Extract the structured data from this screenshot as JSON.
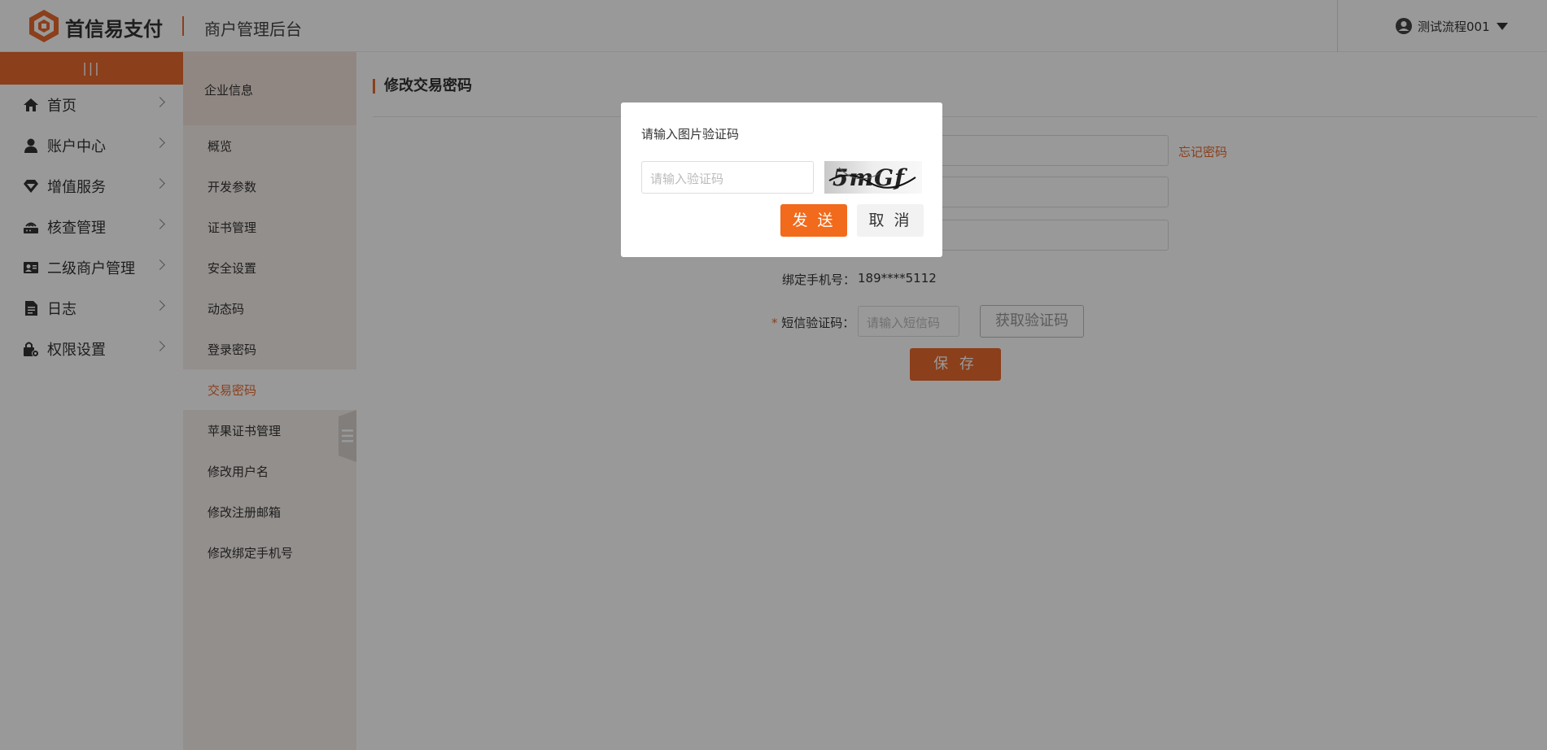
{
  "header": {
    "brand": "首信易支付",
    "subtitle": "商户管理后台",
    "user": "测试流程001"
  },
  "sidebar": {
    "toggle_label": "|||",
    "items": [
      {
        "label": "首页",
        "icon": "home-icon"
      },
      {
        "label": "账户中心",
        "icon": "user-icon"
      },
      {
        "label": "增值服务",
        "icon": "diamond-icon"
      },
      {
        "label": "核查管理",
        "icon": "router-icon"
      },
      {
        "label": "二级商户管理",
        "icon": "id-card-icon"
      },
      {
        "label": "日志",
        "icon": "document-icon"
      },
      {
        "label": "权限设置",
        "icon": "lock-gear-icon"
      }
    ]
  },
  "subnav": {
    "header": "企业信息",
    "items": [
      "概览",
      "开发参数",
      "证书管理",
      "安全设置",
      "动态码",
      "登录密码",
      "交易密码",
      "苹果证书管理",
      "修改用户名",
      "修改注册邮箱",
      "修改绑定手机号"
    ],
    "active_index": 6
  },
  "main": {
    "title": "修改交易密码",
    "forgot_link": "忘记密码",
    "phone_label": "绑定手机号：",
    "phone_value": "189****5112",
    "sms_label": "短信验证码：",
    "sms_required_mark": "*",
    "sms_placeholder": "请输入短信码",
    "sms_button": "获取验证码",
    "save_button": "保 存"
  },
  "modal": {
    "title": "请输入图片验证码",
    "captcha_placeholder": "请输入验证码",
    "captcha_text": "5mGf",
    "send_button": "发 送",
    "cancel_button": "取 消"
  },
  "colors": {
    "accent": "#e86a2e",
    "send_button": "#f26a1b"
  }
}
